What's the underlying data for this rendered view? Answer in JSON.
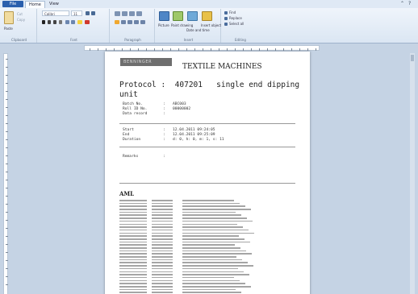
{
  "ribbon": {
    "file_label": "File",
    "tabs": [
      "Home",
      "View"
    ],
    "font_name": "Calibri",
    "font_size": "11",
    "groups": [
      "Clipboard",
      "Font",
      "Paragraph",
      "Insert",
      "Editing"
    ],
    "clipboard": {
      "paste": "Paste",
      "cut": "Cut",
      "copy": "Copy"
    },
    "insert": {
      "picture": "Picture",
      "paint": "Paint drawing",
      "datetime": "Date and time",
      "object": "Insert object"
    },
    "editing": {
      "find": "Find",
      "replace": "Replace",
      "select_all": "Select all"
    }
  },
  "document": {
    "logo": "BENNINGER",
    "title": "TEXTILE MACHINES",
    "protocol_label": "Protocol :",
    "protocol_value": "407201",
    "protocol_desc": "single end dipping",
    "protocol_desc2": "unit",
    "fields": [
      {
        "label": "Batch No.",
        "sep": ":",
        "value": "ABC003"
      },
      {
        "label": "Roll ID No.",
        "sep": ":",
        "value": "00000002"
      },
      {
        "label": "Data record",
        "sep": ":",
        "value": ""
      }
    ],
    "times": [
      {
        "label": "Start",
        "sep": ":",
        "value": "12.04.2011 09:24:05"
      },
      {
        "label": "End",
        "sep": ":",
        "value": "12.04.2011 09:25:09"
      },
      {
        "label": "Duration",
        "sep": ":",
        "value": "d: 0, h: 0, m: 1, s: 11"
      }
    ],
    "remarks_label": "Remarks",
    "remarks_sep": ":",
    "aml_title": "AML"
  }
}
